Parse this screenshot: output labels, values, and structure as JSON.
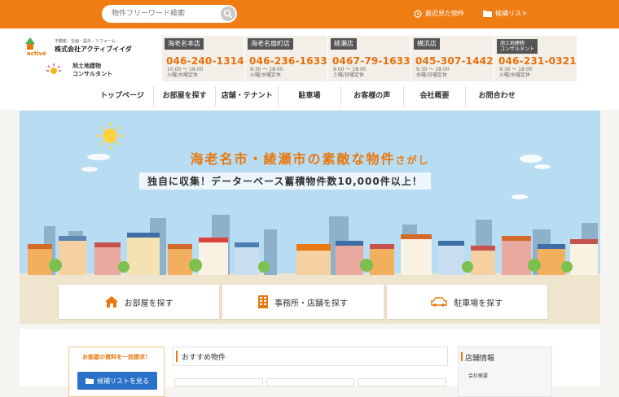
{
  "topbar": {
    "search_placeholder": "物件フリーワード検索",
    "recent_label": "最近見た物件",
    "favorites_label": "候補リスト"
  },
  "logo": {
    "company_tagline": "不動産／企画・設計／リフォーム",
    "company_name": "株式会社アクティブイイダ",
    "brand_mark": "iida active",
    "consult_name_1": "旭土地建物",
    "consult_name_2": "コンサルタント"
  },
  "stores": [
    {
      "name": "海老名本店",
      "tel": "046-240-1314",
      "hours": "10:00 〜 18:00\n火曜/水曜定休"
    },
    {
      "name": "海老名扇町店",
      "tel": "046-236-1633",
      "hours": "9:30 〜 18:00\n火曜/水曜定休"
    },
    {
      "name": "綾瀬店",
      "tel": "0467-79-1633",
      "hours": "9:00 〜 18:00\n土曜/日曜定休"
    },
    {
      "name": "横浜店",
      "tel": "045-307-1442",
      "hours": "9:30 〜 18:00\n水曜/日曜定休"
    },
    {
      "name": "旭土地建物\nコンサルタント",
      "tel": "046-231-0321",
      "hours": "9:30 〜 18:00\n火曜/水曜定休"
    }
  ],
  "nav": [
    "トップページ",
    "お部屋を探す",
    "店舗・テナント",
    "駐車場",
    "お客様の声",
    "会社概要",
    "お問合わせ"
  ],
  "hero": {
    "title_main": "海老名市・綾瀬市の素敵な物件",
    "title_suffix": "さがし",
    "subtitle": "独自に収集！データーベース蓄積物件数10,000件以上！"
  },
  "categories": [
    {
      "label": "お部屋を探す",
      "icon": "house-icon"
    },
    {
      "label": "事務所・店舗を探す",
      "icon": "building-icon"
    },
    {
      "label": "駐車場を探す",
      "icon": "car-icon"
    }
  ],
  "sidebar_request": {
    "title": "お部屋の資料を一括請求！",
    "button": "候補リストを見る"
  },
  "recommended_title": "おすすめ物件",
  "shop_info": {
    "title": "店舗情報",
    "item": "会社概要"
  },
  "colors": {
    "accent": "#f07d14",
    "sky": "#b8dcf2",
    "link_blue": "#2a71c9"
  }
}
